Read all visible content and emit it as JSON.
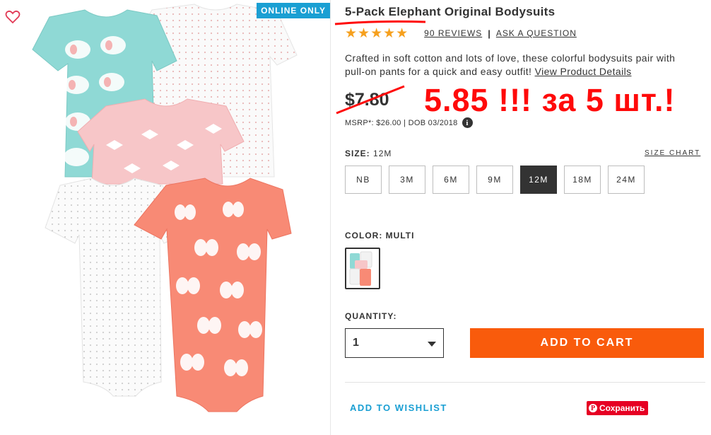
{
  "badge": "ONLINE ONLY",
  "product": {
    "title": "5-Pack Elephant Original Bodysuits",
    "stars": "★★★★★",
    "reviews": "90 REVIEWS",
    "separator": "|",
    "ask": "ASK A QUESTION",
    "description": "Crafted in soft cotton and lots of love, these colorful bodysuits pair with pull-on pants for a quick and easy outfit!",
    "details_link": "View Product Details"
  },
  "price": {
    "old": "$7.80",
    "promo": "5.85 !!! за 5 шт.!",
    "msrp": "MSRP*: $26.00 | DOB 03/2018",
    "info_glyph": "i"
  },
  "size": {
    "label": "SIZE:",
    "selected": "12M",
    "chart_link": "SIZE CHART",
    "options": [
      "NB",
      "3M",
      "6M",
      "9M",
      "12M",
      "18M",
      "24M"
    ]
  },
  "color": {
    "label": "COLOR:",
    "value": "MULTI"
  },
  "quantity": {
    "label": "QUANTITY:",
    "value": "1"
  },
  "actions": {
    "add_to_cart": "ADD TO CART",
    "wishlist": "ADD TO WISHLIST",
    "pin_save": "Сохранить",
    "pin_glyph": "P"
  },
  "colors": {
    "accent_blue": "#1a9fd3",
    "cart_orange": "#f95b0c",
    "star_gold": "#f6a01e",
    "annotation_red": "#ff0a0a",
    "pinterest_red": "#e60023"
  }
}
